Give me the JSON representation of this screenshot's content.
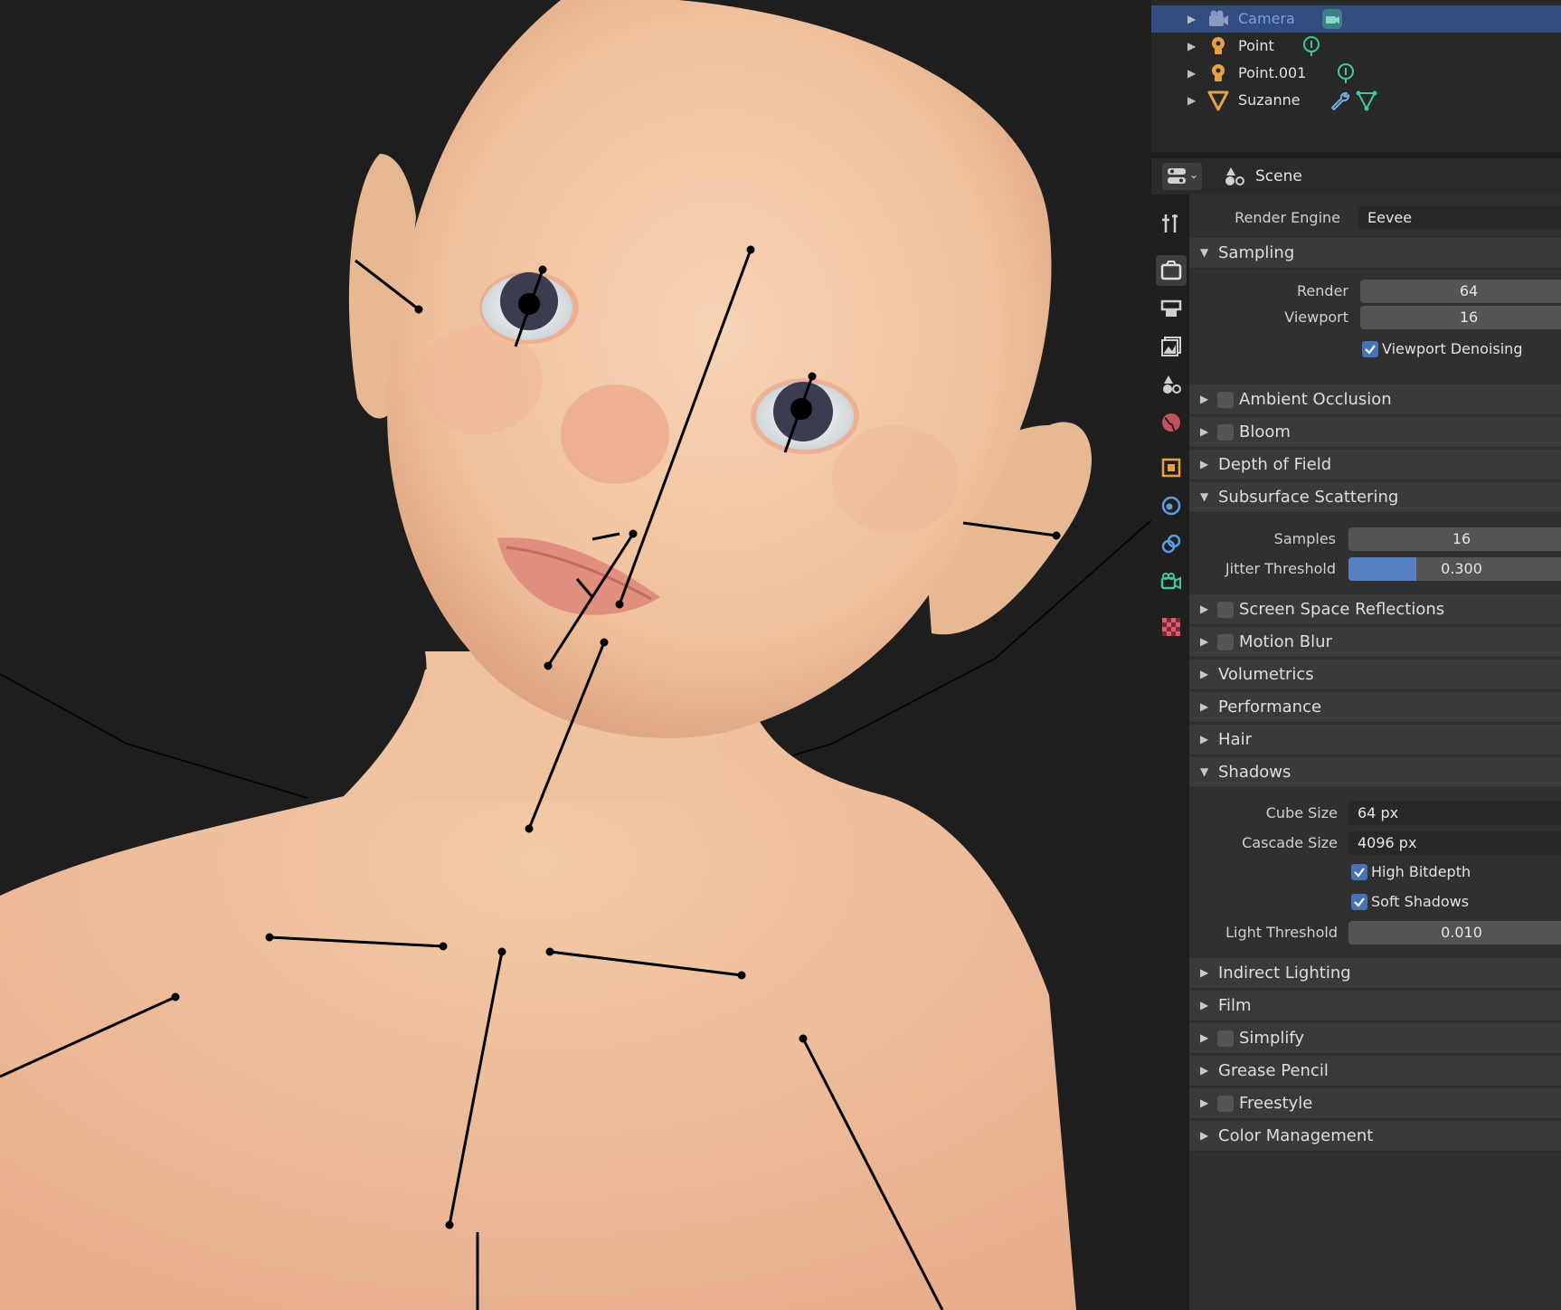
{
  "outliner": {
    "items": [
      {
        "label": "Camera",
        "icon": "camera-icon",
        "extra_icon": "camera-data-icon",
        "selected": true
      },
      {
        "label": "Point",
        "icon": "light-icon",
        "extra_icon": "light-data-icon",
        "selected": false
      },
      {
        "label": "Point.001",
        "icon": "light-icon",
        "extra_icon": "light-data-icon",
        "selected": false
      },
      {
        "label": "Suzanne",
        "icon": "mesh-icon",
        "extra_icon": "modifier-wrench-icon",
        "extra_icon_2": "mesh-data-icon",
        "selected": false
      }
    ]
  },
  "properties": {
    "header": {
      "editor_icon": "editor-type-icon",
      "context_icon": "scene-icon",
      "context": "Scene"
    },
    "tabs": [
      "tool-icon",
      "render-icon",
      "output-icon",
      "view-layer-icon",
      "scene-icon",
      "world-icon",
      "object-icon",
      "physics-icon",
      "constraints-icon",
      "object-data-icon",
      "texture-icon"
    ],
    "render_engine": {
      "label": "Render Engine",
      "value": "Eevee"
    },
    "sampling": {
      "title": "Sampling",
      "render_label": "Render",
      "render_value": "64",
      "viewport_label": "Viewport",
      "viewport_value": "16",
      "denoise_label": "Viewport Denoising",
      "denoise_checked": true
    },
    "ambient_occlusion": {
      "title": "Ambient Occlusion",
      "enabled": false
    },
    "bloom": {
      "title": "Bloom",
      "enabled": false
    },
    "depth_of_field": {
      "title": "Depth of Field"
    },
    "subsurface": {
      "title": "Subsurface Scattering",
      "samples_label": "Samples",
      "samples_value": "16",
      "jitter_label": "Jitter Threshold",
      "jitter_value": "0.300",
      "jitter_fraction": 0.3
    },
    "ssr": {
      "title": "Screen Space Reflections",
      "enabled": false
    },
    "motion_blur": {
      "title": "Motion Blur",
      "enabled": false
    },
    "volumetrics": {
      "title": "Volumetrics"
    },
    "performance": {
      "title": "Performance"
    },
    "hair": {
      "title": "Hair"
    },
    "shadows": {
      "title": "Shadows",
      "cube_label": "Cube Size",
      "cube_value": "64 px",
      "cascade_label": "Cascade Size",
      "cascade_value": "4096 px",
      "high_bitdepth_label": "High Bitdepth",
      "high_bitdepth": true,
      "soft_shadows_label": "Soft Shadows",
      "soft_shadows": true,
      "light_threshold_label": "Light Threshold",
      "light_threshold_value": "0.010"
    },
    "indirect_lighting": {
      "title": "Indirect Lighting"
    },
    "film": {
      "title": "Film"
    },
    "simplify": {
      "title": "Simplify",
      "enabled": false
    },
    "grease_pencil": {
      "title": "Grease Pencil"
    },
    "freestyle": {
      "title": "Freestyle",
      "enabled": false
    },
    "color_management": {
      "title": "Color Management"
    }
  },
  "colors": {
    "selection": "#334d80",
    "accent": "#4772b3",
    "light_icon": "#e6a04a",
    "data_icon": "#3ec7a0"
  }
}
